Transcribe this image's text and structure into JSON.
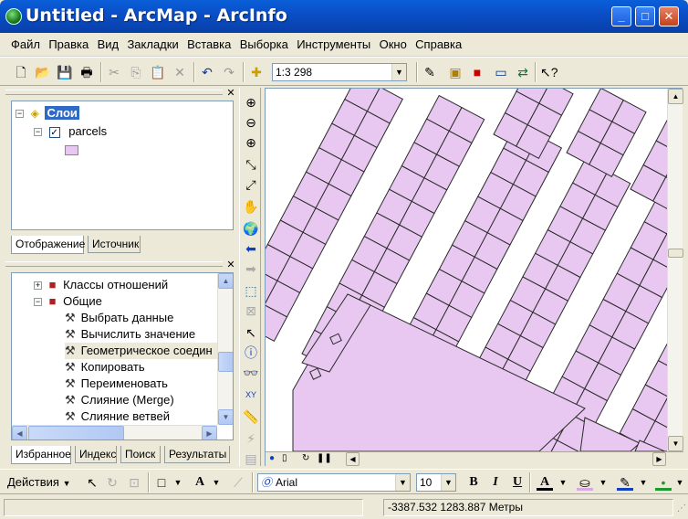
{
  "window": {
    "title": "Untitled - ArcMap - ArcInfo"
  },
  "menu": [
    "Файл",
    "Правка",
    "Вид",
    "Закладки",
    "Вставка",
    "Выборка",
    "Инструменты",
    "Окно",
    "Справка"
  ],
  "toolbar": {
    "scale": "1:3 298"
  },
  "toc": {
    "root_label": "Слои",
    "layer_label": "parcels",
    "layer_checked": true,
    "symbol_color": "#e8c8f0",
    "tabs": [
      "Отображение",
      "Источник"
    ],
    "active_tab": 0
  },
  "toolbox": {
    "items": [
      {
        "label": "Классы отношений",
        "kind": "toolset"
      },
      {
        "label": "Общие",
        "kind": "toolset"
      },
      {
        "label": "Выбрать данные",
        "kind": "tool"
      },
      {
        "label": "Вычислить значение",
        "kind": "tool"
      },
      {
        "label": "Геометрическое соедин",
        "kind": "tool"
      },
      {
        "label": "Копировать",
        "kind": "tool"
      },
      {
        "label": "Переименовать",
        "kind": "tool"
      },
      {
        "label": "Слияние (Merge)",
        "kind": "tool"
      },
      {
        "label": "Слияние ветвей",
        "kind": "tool"
      }
    ],
    "tabs": [
      "Избранное",
      "Индекс",
      "Поиск",
      "Результаты"
    ],
    "active_tab": 0
  },
  "drawing": {
    "actions_label": "Действия",
    "font_name": "Arial",
    "font_size": "10",
    "bold": "B",
    "italic": "I",
    "underline": "U",
    "font_color_glyph": "A"
  },
  "status": {
    "coords": "-3387.532  1283.887 Метры"
  },
  "colors": {
    "parcel_fill": "#e8c8f0",
    "parcel_stroke": "#2a2a2a",
    "selection": "#316ac5"
  }
}
